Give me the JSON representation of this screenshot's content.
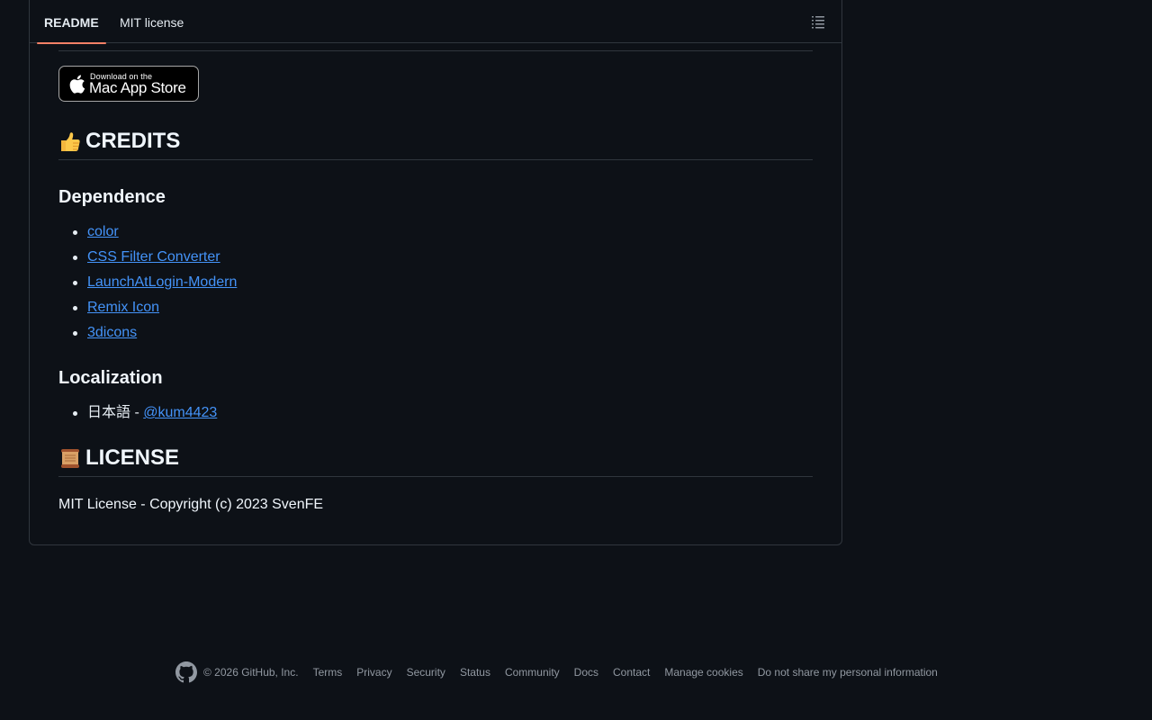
{
  "tabs": [
    {
      "label": "README",
      "active": true
    },
    {
      "label": "MIT license",
      "active": false
    }
  ],
  "toc_icon": "list-unordered-icon",
  "badge": {
    "small_text": "Download on the",
    "big_text": "Mac App Store",
    "icon": "apple-logo-icon"
  },
  "credits": {
    "emoji": "thumbs-up-emoji",
    "heading": "CREDITS",
    "dependence": {
      "heading": "Dependence",
      "items": [
        "color",
        "CSS Filter Converter",
        "LaunchAtLogin-Modern",
        "Remix Icon",
        "3dicons"
      ]
    },
    "localization": {
      "heading": "Localization",
      "language": "日本語 - ",
      "contributor": "@kum4423"
    }
  },
  "license": {
    "emoji": "scroll-emoji",
    "heading": "LICENSE",
    "text": "MIT License - Copyright (c) 2023 SvenFE"
  },
  "footer": {
    "logo_icon": "github-mark-icon",
    "copyright": "© 2026 GitHub, Inc.",
    "links": [
      "Terms",
      "Privacy",
      "Security",
      "Status",
      "Community",
      "Docs",
      "Contact",
      "Manage cookies",
      "Do not share my personal information"
    ]
  },
  "colors": {
    "background": "#0d1117",
    "border": "#30363d",
    "link": "#4493f8",
    "tab_underline": "#f78166",
    "footer_text": "#9198a1"
  }
}
